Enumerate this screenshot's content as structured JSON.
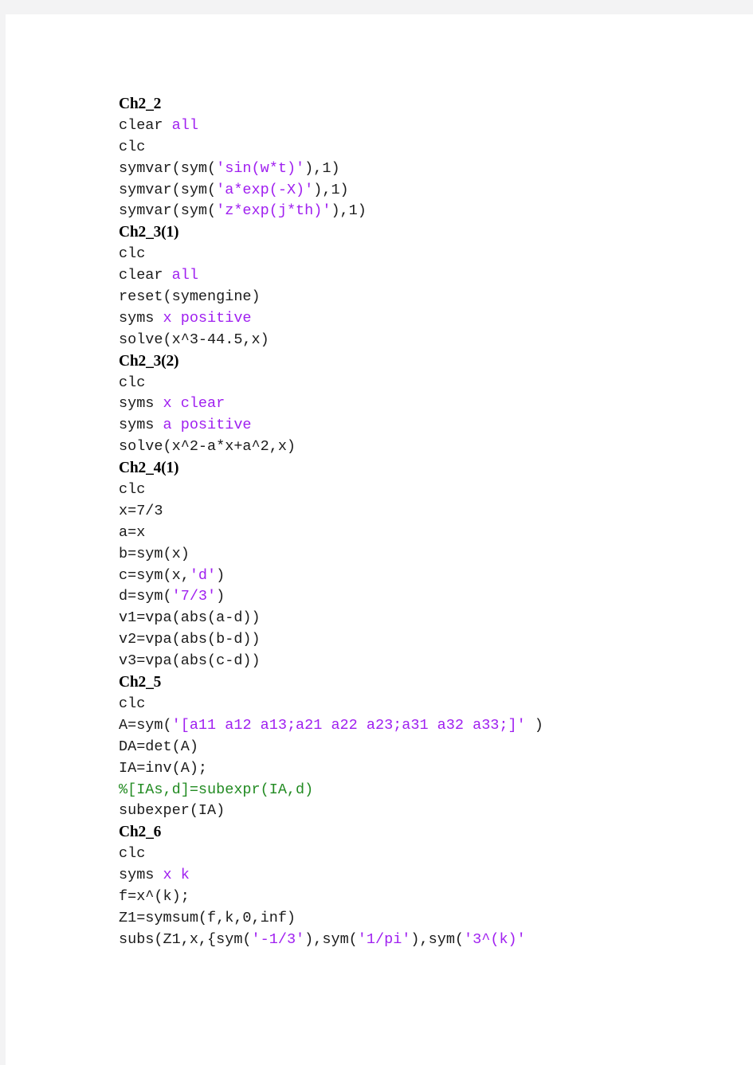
{
  "document": {
    "kind": "matlab-code-listing",
    "page_background": "#ffffff",
    "gutter_color": "#f3f3f4",
    "colors": {
      "code": "#1b1b1b",
      "keyword": "#a020f0",
      "string": "#a020f0",
      "comment": "#228b22",
      "heading": "#000000"
    }
  },
  "lines": [
    {
      "type": "heading",
      "text": "Ch2_2"
    },
    {
      "type": "code",
      "spans": [
        {
          "t": "clear ",
          "c": "code"
        },
        {
          "t": "all",
          "c": "kw"
        }
      ]
    },
    {
      "type": "code",
      "spans": [
        {
          "t": "clc",
          "c": "code"
        }
      ]
    },
    {
      "type": "code",
      "spans": [
        {
          "t": "symvar(sym(",
          "c": "code"
        },
        {
          "t": "'sin(w*t)'",
          "c": "str"
        },
        {
          "t": "),1)",
          "c": "code"
        }
      ]
    },
    {
      "type": "code",
      "spans": [
        {
          "t": "symvar(sym(",
          "c": "code"
        },
        {
          "t": "'a*exp(-X)'",
          "c": "str"
        },
        {
          "t": "),1)",
          "c": "code"
        }
      ]
    },
    {
      "type": "code",
      "spans": [
        {
          "t": "symvar(sym(",
          "c": "code"
        },
        {
          "t": "'z*exp(j*th)'",
          "c": "str"
        },
        {
          "t": "),1)",
          "c": "code"
        }
      ]
    },
    {
      "type": "heading",
      "text": "Ch2_3(1)"
    },
    {
      "type": "code",
      "spans": [
        {
          "t": "clc",
          "c": "code"
        }
      ]
    },
    {
      "type": "code",
      "spans": [
        {
          "t": "clear ",
          "c": "code"
        },
        {
          "t": "all",
          "c": "kw"
        }
      ]
    },
    {
      "type": "code",
      "spans": [
        {
          "t": "reset(symengine)",
          "c": "code"
        }
      ]
    },
    {
      "type": "code",
      "spans": [
        {
          "t": "syms ",
          "c": "code"
        },
        {
          "t": "x positive",
          "c": "kw"
        }
      ]
    },
    {
      "type": "code",
      "spans": [
        {
          "t": "solve(x^3-44.5,x)",
          "c": "code"
        }
      ]
    },
    {
      "type": "heading",
      "text": "Ch2_3(2)"
    },
    {
      "type": "code",
      "spans": [
        {
          "t": "clc",
          "c": "code"
        }
      ]
    },
    {
      "type": "code",
      "spans": [
        {
          "t": "syms ",
          "c": "code"
        },
        {
          "t": "x clear",
          "c": "kw"
        }
      ]
    },
    {
      "type": "code",
      "spans": [
        {
          "t": "syms ",
          "c": "code"
        },
        {
          "t": "a positive",
          "c": "kw"
        }
      ]
    },
    {
      "type": "code",
      "spans": [
        {
          "t": "solve(x^2-a*x+a^2,x)",
          "c": "code"
        }
      ]
    },
    {
      "type": "heading",
      "text": "Ch2_4(1)"
    },
    {
      "type": "code",
      "spans": [
        {
          "t": "clc",
          "c": "code"
        }
      ]
    },
    {
      "type": "code",
      "spans": [
        {
          "t": "x=7/3",
          "c": "code"
        }
      ]
    },
    {
      "type": "code",
      "spans": [
        {
          "t": "a=x",
          "c": "code"
        }
      ]
    },
    {
      "type": "code",
      "spans": [
        {
          "t": "b=sym(x)",
          "c": "code"
        }
      ]
    },
    {
      "type": "code",
      "spans": [
        {
          "t": "c=sym(x,",
          "c": "code"
        },
        {
          "t": "'d'",
          "c": "str"
        },
        {
          "t": ")",
          "c": "code"
        }
      ]
    },
    {
      "type": "code",
      "spans": [
        {
          "t": "d=sym(",
          "c": "code"
        },
        {
          "t": "'7/3'",
          "c": "str"
        },
        {
          "t": ")",
          "c": "code"
        }
      ]
    },
    {
      "type": "code",
      "spans": [
        {
          "t": "v1=vpa(abs(a-d))",
          "c": "code"
        }
      ]
    },
    {
      "type": "code",
      "spans": [
        {
          "t": "v2=vpa(abs(b-d))",
          "c": "code"
        }
      ]
    },
    {
      "type": "code",
      "spans": [
        {
          "t": "v3=vpa(abs(c-d))",
          "c": "code"
        }
      ]
    },
    {
      "type": "heading",
      "text": "Ch2_5"
    },
    {
      "type": "code",
      "spans": [
        {
          "t": "clc",
          "c": "code"
        }
      ]
    },
    {
      "type": "code",
      "spans": [
        {
          "t": "A=sym(",
          "c": "code"
        },
        {
          "t": "'[a11 a12 a13;a21 a22 a23;a31 a32 a33;]'",
          "c": "str"
        },
        {
          "t": " )",
          "c": "code"
        }
      ]
    },
    {
      "type": "code",
      "spans": [
        {
          "t": "DA=det(A)",
          "c": "code"
        }
      ]
    },
    {
      "type": "code",
      "spans": [
        {
          "t": "IA=inv(A);",
          "c": "code"
        }
      ]
    },
    {
      "type": "code",
      "spans": [
        {
          "t": "%[IAs,d]=subexpr(IA,d)",
          "c": "cmt"
        }
      ]
    },
    {
      "type": "code",
      "spans": [
        {
          "t": "subexper(IA)",
          "c": "code"
        }
      ]
    },
    {
      "type": "heading",
      "text": "Ch2_6"
    },
    {
      "type": "code",
      "spans": [
        {
          "t": "clc",
          "c": "code"
        }
      ]
    },
    {
      "type": "code",
      "spans": [
        {
          "t": "syms ",
          "c": "code"
        },
        {
          "t": "x k",
          "c": "kw"
        }
      ]
    },
    {
      "type": "code",
      "spans": [
        {
          "t": "f=x^(k);",
          "c": "code"
        }
      ]
    },
    {
      "type": "code",
      "spans": [
        {
          "t": "Z1=symsum(f,k,0,inf)",
          "c": "code"
        }
      ]
    },
    {
      "type": "code",
      "spans": [
        {
          "t": "subs(Z1,x,{sym(",
          "c": "code"
        },
        {
          "t": "'-1/3'",
          "c": "str"
        },
        {
          "t": "),sym(",
          "c": "code"
        },
        {
          "t": "'1/pi'",
          "c": "str"
        },
        {
          "t": "),sym(",
          "c": "code"
        },
        {
          "t": "'3^(k)'",
          "c": "str"
        }
      ]
    }
  ]
}
